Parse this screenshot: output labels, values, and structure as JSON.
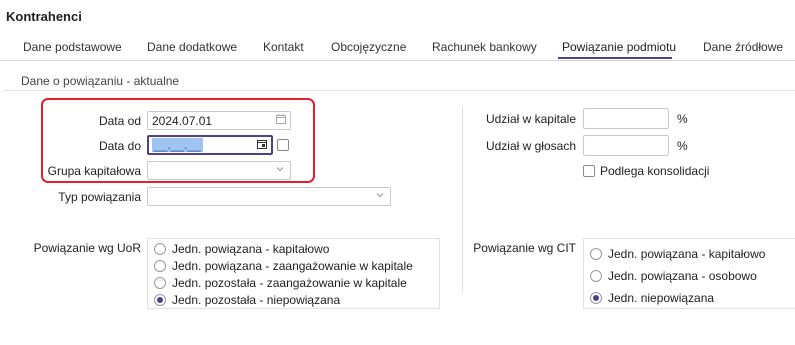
{
  "header": {
    "title": "Kontrahenci"
  },
  "tabs": [
    {
      "label": "Dane podstawowe"
    },
    {
      "label": "Dane dodatkowe"
    },
    {
      "label": "Kontakt"
    },
    {
      "label": "Obcojęzyczne"
    },
    {
      "label": "Rachunek bankowy"
    },
    {
      "label": "Powiązanie podmiotu",
      "active": true
    },
    {
      "label": "Dane źródłowe"
    }
  ],
  "section": {
    "title": "Dane o powiązaniu - aktualne"
  },
  "left_form": {
    "data_od": {
      "label": "Data od",
      "value": "2024.07.01"
    },
    "data_do": {
      "label": "Data do",
      "value": "__.__.__"
    },
    "grupa": {
      "label": "Grupa kapitałowa",
      "value": ""
    },
    "typ": {
      "label": "Typ powiązania",
      "value": ""
    }
  },
  "right_form": {
    "udzial_kapital": {
      "label": "Udział w kapitale",
      "value": "",
      "unit": "%"
    },
    "udzial_glosy": {
      "label": "Udział w głosach",
      "value": "",
      "unit": "%"
    },
    "konsolidacja": {
      "label": "Podlega konsolidacji",
      "checked": false
    }
  },
  "uor": {
    "label": "Powiązanie wg UoR",
    "options": [
      {
        "label": "Jedn. powiązana - kapitałowo",
        "selected": false
      },
      {
        "label": "Jedn. powiązana - zaangażowanie w kapitale",
        "selected": false
      },
      {
        "label": "Jedn. pozostała - zaangażowanie w kapitale",
        "selected": false
      },
      {
        "label": "Jedn. pozostała - niepowiązana",
        "selected": true
      }
    ]
  },
  "cit": {
    "label": "Powiązanie wg CIT",
    "options": [
      {
        "label": "Jedn. powiązana - kapitałowo",
        "selected": false
      },
      {
        "label": "Jedn. powiązana - osobowo",
        "selected": false
      },
      {
        "label": "Jedn. niepowiązana",
        "selected": true
      }
    ]
  },
  "colors": {
    "accent": "#4f3f8f",
    "highlight_border": "#e0202c",
    "selection": "#9ec4ef"
  }
}
